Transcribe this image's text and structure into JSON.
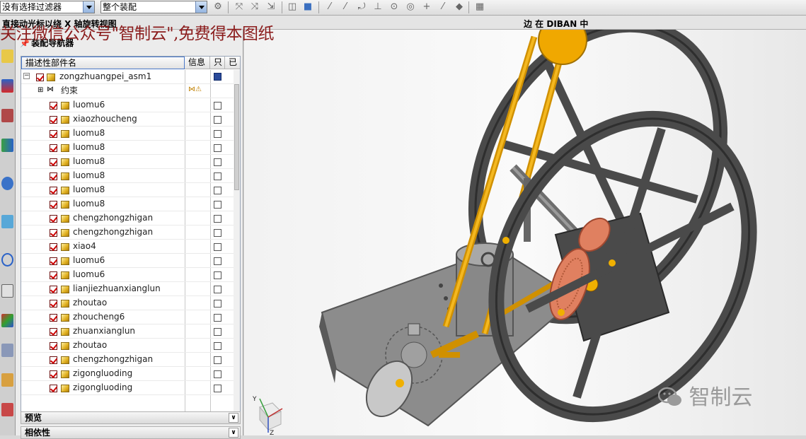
{
  "toolbar": {
    "filter_value": "没有选择过滤器",
    "assembly_value": "整个装配"
  },
  "status": {
    "left_text": "直接动光标以绕 X 轴旋转视图",
    "right_text": "边 在 DIBAN 中"
  },
  "watermark": "关注微信公众号\"智制云\",免费得本图纸",
  "navigator": {
    "title": "装配导航器",
    "columns": [
      "描述性部件名",
      "信息",
      "只",
      "已"
    ],
    "root": "zongzhuangpei_asm1",
    "constraint": "约束",
    "parts": [
      "luomu6",
      "xiaozhoucheng",
      "luomu8",
      "luomu8",
      "luomu8",
      "luomu8",
      "luomu8",
      "luomu8",
      "chengzhongzhigan",
      "chengzhongzhigan",
      "xiao4",
      "luomu6",
      "luomu6",
      "lianjiezhuanxianglun",
      "zhoutao",
      "zhoucheng6",
      "zhuanxianglun",
      "zhoutao",
      "chengzhongzhigan",
      "zigongluoding",
      "zigongluoding"
    ]
  },
  "sections": {
    "preview": "预览",
    "dependency": "相依性"
  },
  "viewport": {
    "logo_text": "智制云",
    "triad_labels": [
      "Y",
      "Z"
    ]
  },
  "icons": [
    "chevron-down-icon",
    "cube-icon",
    "checkbox-checked-icon",
    "save-icon",
    "expand-icon",
    "constraint-icon",
    "wechat-icon"
  ]
}
